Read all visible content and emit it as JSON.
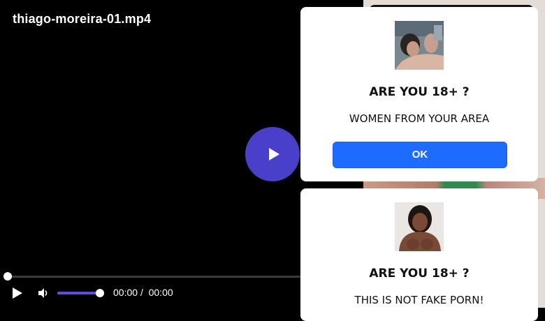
{
  "player": {
    "title": "thiago-moreira-01.mp4",
    "time_current": "00:00",
    "time_separator": "/",
    "time_duration": "00:00",
    "progress": 0,
    "volume": 1.0,
    "accent_color": "#4a3fc8"
  },
  "popups": [
    {
      "title": "ARE YOU 18+ ?",
      "subtitle": "WOMEN FROM YOUR AREA",
      "button_label": "OK"
    },
    {
      "title": "ARE YOU 18+ ?",
      "subtitle": "THIS IS NOT FAKE PORN!"
    }
  ],
  "colors": {
    "button_blue": "#1e6bff",
    "background": "#000000"
  }
}
